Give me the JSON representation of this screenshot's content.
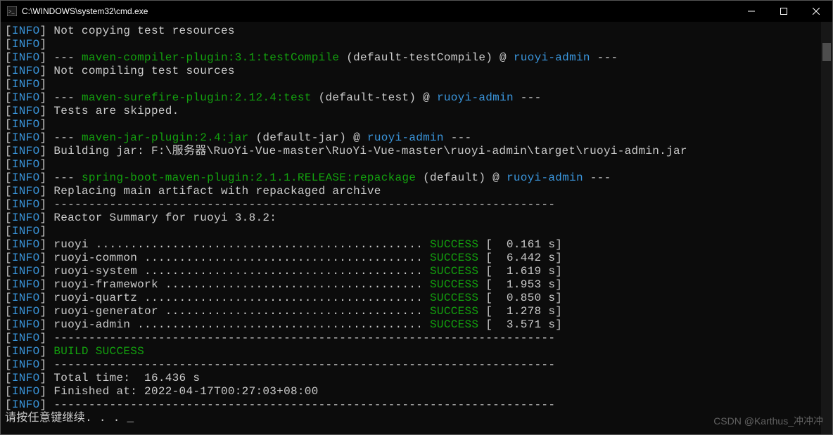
{
  "titlebar": {
    "title": "C:\\WINDOWS\\system32\\cmd.exe"
  },
  "colors": {
    "blue": "#3a96dd",
    "green": "#13a10e",
    "white": "#cccccc",
    "yellow": "#c19c00",
    "bg": "#0c0c0c"
  },
  "seg": {
    "lb": "[",
    "rb": "]",
    "rbracket_space": "] ",
    "info": "INFO",
    "dashes": "--- ",
    "sep_long": "------------------------------------------------------------------------",
    "at": " @ ",
    "trailing_dashes": " ---",
    "open_paren": " (",
    "close_paren": ")"
  },
  "lines": {
    "l1_text": "Not copying test resources",
    "l3_plugin": "maven-compiler-plugin:3.1:testCompile",
    "l3_goal": "default-testCompile",
    "l3_module": "ruoyi-admin",
    "l4_text": "Not compiling test sources",
    "l6_plugin": "maven-surefire-plugin:2.12.4:test",
    "l6_goal": "default-test",
    "l6_module": "ruoyi-admin",
    "l7_text": "Tests are skipped.",
    "l9_plugin": "maven-jar-plugin:2.4:jar",
    "l9_goal": "default-jar",
    "l9_module": "ruoyi-admin",
    "l10_text": "Building jar: F:\\服务器\\RuoYi-Vue-master\\RuoYi-Vue-master\\ruoyi-admin\\target\\ruoyi-admin.jar",
    "l12_plugin": "spring-boot-maven-plugin:2.1.1.RELEASE:repackage",
    "l12_goal": "default",
    "l12_module": "ruoyi-admin",
    "l13_text": "Replacing main artifact with repackaged archive",
    "l15_text": "Reactor Summary for ruoyi 3.8.2:",
    "summary": [
      {
        "name": "ruoyi ............................................... ",
        "status": "SUCCESS",
        "time": " [  0.161 s]"
      },
      {
        "name": "ruoyi-common ........................................ ",
        "status": "SUCCESS",
        "time": " [  6.442 s]"
      },
      {
        "name": "ruoyi-system ........................................ ",
        "status": "SUCCESS",
        "time": " [  1.619 s]"
      },
      {
        "name": "ruoyi-framework ..................................... ",
        "status": "SUCCESS",
        "time": " [  1.953 s]"
      },
      {
        "name": "ruoyi-quartz ........................................ ",
        "status": "SUCCESS",
        "time": " [  0.850 s]"
      },
      {
        "name": "ruoyi-generator ..................................... ",
        "status": "SUCCESS",
        "time": " [  1.278 s]"
      },
      {
        "name": "ruoyi-admin ......................................... ",
        "status": "SUCCESS",
        "time": " [  3.571 s]"
      }
    ],
    "build_success": "BUILD SUCCESS",
    "total_time": "Total time:  16.436 s",
    "finished_at": "Finished at: 2022-04-17T00:27:03+08:00",
    "press_any_key": "请按任意键继续. . . _"
  },
  "watermark": "CSDN @Karthus_冲冲冲"
}
